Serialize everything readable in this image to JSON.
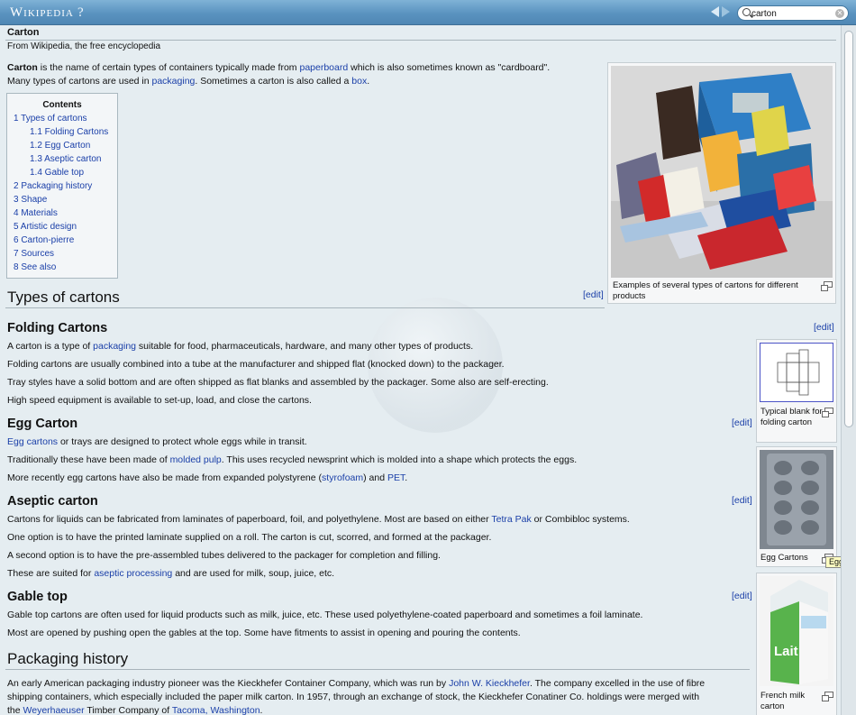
{
  "window": {
    "logo": "Wikipedia",
    "help": "?",
    "search": {
      "value": "carton",
      "placeholder": ""
    }
  },
  "article": {
    "title": "Carton",
    "tagline": "From Wikipedia, the free encyclopedia",
    "intro_line1": [
      {
        "t": "Carton",
        "b": true
      },
      {
        "t": " is the name of certain types of containers typically made from "
      },
      {
        "t": "paperboard",
        "link": true
      },
      {
        "t": " which is also sometimes known as \"cardboard\"."
      }
    ],
    "intro_line2": [
      {
        "t": "Many types of cartons are used in "
      },
      {
        "t": "packaging",
        "link": true
      },
      {
        "t": ". Sometimes a carton is also called a "
      },
      {
        "t": "box",
        "link": true
      },
      {
        "t": "."
      }
    ]
  },
  "toc": {
    "title": "Contents",
    "items": [
      "1 Types of cartons",
      "1.1 Folding Cartons",
      "1.2 Egg Carton",
      "1.3 Aseptic carton",
      "1.4 Gable top",
      "2 Packaging history",
      "3 Shape",
      "4 Materials",
      "5 Artistic design",
      "6 Carton-pierre",
      "7 Sources",
      "8 See also"
    ]
  },
  "edit_label": "[edit]",
  "sections": {
    "types": "Types of cartons",
    "folding": {
      "heading": "Folding Cartons",
      "lines": [
        [
          {
            "t": "A carton is a type of "
          },
          {
            "t": "packaging",
            "link": true
          },
          {
            "t": " suitable for food, pharmaceuticals, hardware, and many other types of products."
          }
        ],
        [
          {
            "t": "Folding cartons are usually combined into a tube at the manufacturer and shipped flat (knocked down) to the packager."
          }
        ],
        [
          {
            "t": "Tray styles have a solid bottom and are often shipped as flat blanks and assembled by the packager. Some also are self-erecting."
          }
        ],
        [
          {
            "t": "High speed equipment is available to set-up, load, and close the cartons."
          }
        ]
      ]
    },
    "egg": {
      "heading": "Egg Carton",
      "lines": [
        [
          {
            "t": "Egg cartons",
            "link": true
          },
          {
            "t": " or trays are designed to protect whole eggs while in transit."
          }
        ],
        [
          {
            "t": "Traditionally these have been made of "
          },
          {
            "t": "molded pulp",
            "link": true
          },
          {
            "t": ". This uses recycled newsprint which is molded into a shape which protects the eggs."
          }
        ],
        [
          {
            "t": "More recently egg cartons have also be made from expanded polystyrene ("
          },
          {
            "t": "styrofoam",
            "link": true
          },
          {
            "t": ") and "
          },
          {
            "t": "PET",
            "link": true
          },
          {
            "t": "."
          }
        ]
      ]
    },
    "aseptic": {
      "heading": "Aseptic carton",
      "lines": [
        [
          {
            "t": "Cartons for liquids can be fabricated from laminates of paperboard, foil, and polyethylene. Most are based on either "
          },
          {
            "t": "Tetra Pak",
            "link": true
          },
          {
            "t": " or Combibloc systems."
          }
        ],
        [
          {
            "t": "One option is to have the printed laminate supplied on a roll. The carton is cut, scorred, and formed at the packager."
          }
        ],
        [
          {
            "t": "A second option is to have the pre-assembled tubes delivered to the packager for completion and filling."
          }
        ],
        [
          {
            "t": "These are suited for "
          },
          {
            "t": "aseptic processing",
            "link": true
          },
          {
            "t": " and are used for milk, soup, juice, etc."
          }
        ]
      ]
    },
    "gable": {
      "heading": "Gable top",
      "lines": [
        [
          {
            "t": "Gable top cartons are often used for liquid products such as milk, juice, etc. These used polyethylene-coated paperboard and sometimes a foil laminate."
          }
        ],
        [
          {
            "t": "Most are opened by pushing open the gables at the top. Some have fitments to assist in opening and pouring the contents."
          }
        ]
      ]
    },
    "history": {
      "heading": "Packaging history",
      "lines": [
        [
          {
            "t": "An early American packaging industry pioneer was the Kieckhefer Container Company, which was run by "
          },
          {
            "t": "John W. Kieckhefer",
            "link": true
          },
          {
            "t": ". The company excelled in the use of fibre"
          }
        ],
        [
          {
            "t": "shipping containers, which especially included the paper milk carton. In 1957, through an exchange of stock, the Kieckhefer Conatiner Co. holdings were merged with"
          }
        ],
        [
          {
            "t": "the "
          },
          {
            "t": "Weyerhaeuser",
            "link": true
          },
          {
            "t": " Timber Company of "
          },
          {
            "t": "Tacoma, Washington",
            "link": true
          },
          {
            "t": "."
          }
        ]
      ]
    }
  },
  "images": {
    "main_caption": "Examples of several types of cartons for different products",
    "blank_caption": "Typical blank for folding carton",
    "egg_caption": "Egg Cartons",
    "milk_caption": "French milk carton",
    "milk_label": "Lait"
  },
  "tooltip": "Egg Cartons",
  "colors": {
    "link": "#1a3fa8",
    "titlebar": "#5a93c0",
    "content_bg": "#e5edf1"
  }
}
